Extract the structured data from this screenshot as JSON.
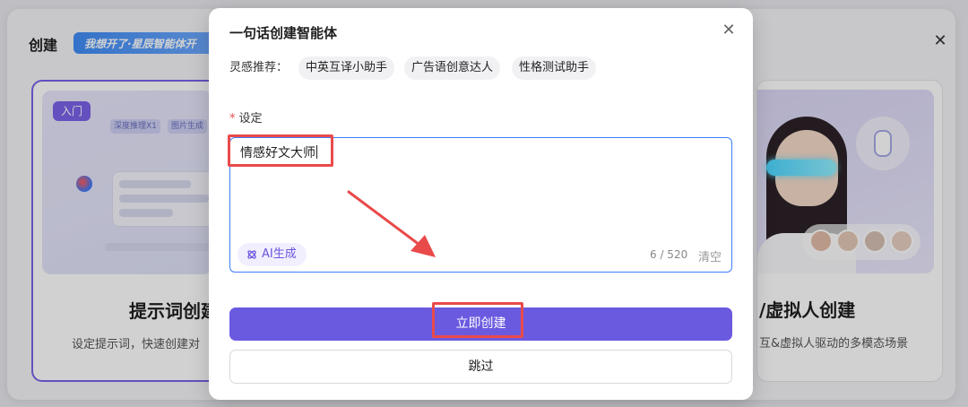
{
  "background": {
    "dialog_title": "创建",
    "banner_text": "我想开了·星辰智能体开",
    "left_card": {
      "tag": "入门",
      "mini_chips": [
        "深度推理X1",
        "图片生成"
      ],
      "heading": "提示词创建",
      "desc": "设定提示词，快速创建对"
    },
    "right_card": {
      "heading": "/虚拟人创建",
      "desc": "互&虚拟人驱动的多模态场景"
    }
  },
  "modal": {
    "title": "一句话创建智能体",
    "inspiration_label": "灵感推荐：",
    "inspiration_chips": [
      "中英互译小助手",
      "广告语创意达人",
      "性格测试助手"
    ],
    "field_label": "设定",
    "textarea_value": "情感好文大师",
    "ai_button": "AI生成",
    "counter": "6 / 520",
    "clear": "清空",
    "primary_button": "立即创建",
    "secondary_button": "跳过"
  },
  "colors": {
    "accent": "#6a5ae0",
    "annotation": "#e94a4a",
    "input_border": "#3d7dff"
  },
  "icons": [
    "close-icon",
    "sparkle-icon",
    "microphone-icon",
    "avatar-icon"
  ]
}
